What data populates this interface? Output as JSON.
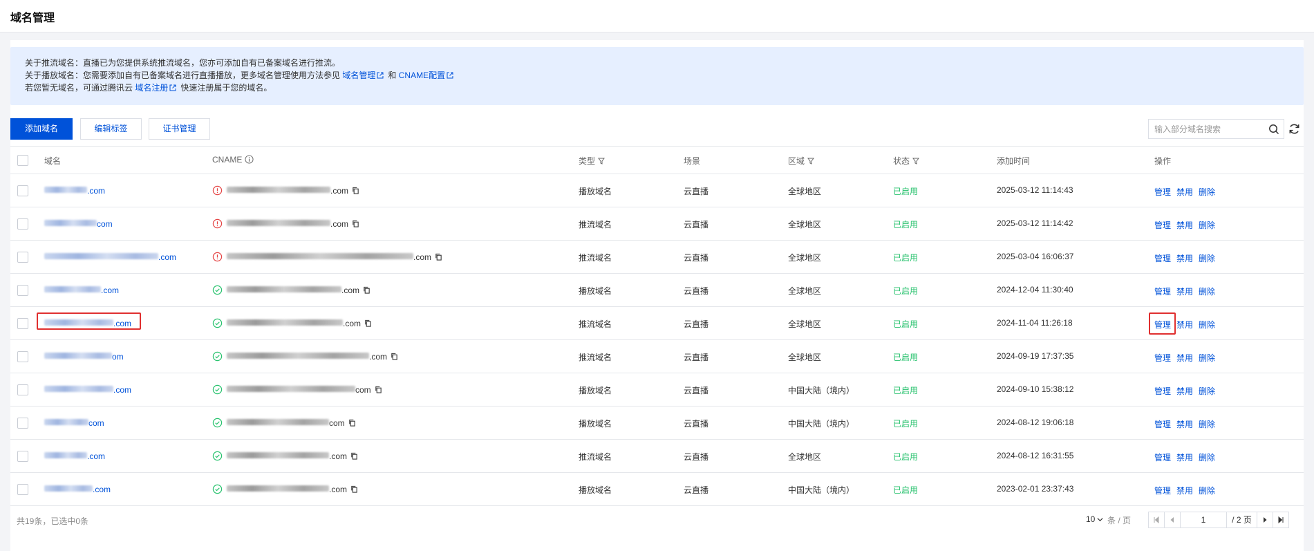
{
  "page": {
    "title": "域名管理"
  },
  "notice": {
    "line1": "关于推流域名：直播已为您提供系统推流域名，您亦可添加自有已备案域名进行推流。",
    "line2_prefix": "关于播放域名：您需要添加自有已备案域名进行直播播放，更多域名管理使用方法参见",
    "link_domain_mgmt": "域名管理",
    "line2_and": "和",
    "link_cname": "CNAME配置",
    "line3_prefix": "若您暂无域名，可通过腾讯云",
    "link_register": "域名注册",
    "line3_suffix": "快速注册属于您的域名。"
  },
  "toolbar": {
    "add_domain": "添加域名",
    "edit_tags": "编辑标签",
    "cert_mgmt": "证书管理",
    "search_placeholder": "输入部分域名搜索"
  },
  "table": {
    "headers": {
      "domain": "域名",
      "cname": "CNAME",
      "type": "类型",
      "scene": "场景",
      "region": "区域",
      "status": "状态",
      "added_time": "添加时间",
      "actions": "操作"
    },
    "rows": [
      {
        "domain_suffix": ".com",
        "cname_status": "error",
        "cname_suffix": ".com",
        "type": "播放域名",
        "scene": "云直播",
        "region": "全球地区",
        "status": "已启用",
        "time": "2025-03-12 11:14:43"
      },
      {
        "domain_suffix": "com",
        "cname_status": "error",
        "cname_suffix": ".com",
        "type": "推流域名",
        "scene": "云直播",
        "region": "全球地区",
        "status": "已启用",
        "time": "2025-03-12 11:14:42"
      },
      {
        "domain_suffix": ".com",
        "cname_status": "error",
        "cname_suffix": ".com",
        "type": "推流域名",
        "scene": "云直播",
        "region": "全球地区",
        "status": "已启用",
        "time": "2025-03-04 16:06:37"
      },
      {
        "domain_suffix": ".com",
        "cname_status": "ok",
        "cname_suffix": ".com",
        "type": "播放域名",
        "scene": "云直播",
        "region": "全球地区",
        "status": "已启用",
        "time": "2024-12-04 11:30:40"
      },
      {
        "domain_suffix": ".com",
        "cname_status": "ok",
        "cname_suffix": ".com",
        "type": "推流域名",
        "scene": "云直播",
        "region": "全球地区",
        "status": "已启用",
        "time": "2024-11-04 11:26:18"
      },
      {
        "domain_suffix": "om",
        "cname_status": "ok",
        "cname_suffix": ".com",
        "type": "推流域名",
        "scene": "云直播",
        "region": "全球地区",
        "status": "已启用",
        "time": "2024-09-19 17:37:35"
      },
      {
        "domain_suffix": ".com",
        "cname_status": "ok",
        "cname_suffix": "com",
        "type": "播放域名",
        "scene": "云直播",
        "region": "中国大陆（境内）",
        "status": "已启用",
        "time": "2024-09-10 15:38:12"
      },
      {
        "domain_suffix": "com",
        "cname_status": "ok",
        "cname_suffix": "com",
        "type": "播放域名",
        "scene": "云直播",
        "region": "中国大陆（境内）",
        "status": "已启用",
        "time": "2024-08-12 19:06:18"
      },
      {
        "domain_suffix": ".com",
        "cname_status": "ok",
        "cname_suffix": ".com",
        "type": "推流域名",
        "scene": "云直播",
        "region": "全球地区",
        "status": "已启用",
        "time": "2024-08-12 16:31:55"
      },
      {
        "domain_suffix": ".com",
        "cname_status": "ok",
        "cname_suffix": ".com",
        "type": "播放域名",
        "scene": "云直播",
        "region": "中国大陆（境内）",
        "status": "已启用",
        "time": "2023-02-01 23:37:43"
      }
    ],
    "actions": {
      "manage": "管理",
      "disable": "禁用",
      "delete": "删除"
    }
  },
  "footer": {
    "total": "共19条，已选中0条",
    "page_size": "10",
    "page_size_unit": "条 / 页",
    "current_page": "1",
    "total_pages": "/ 2 页"
  },
  "colors": {
    "accent": "#0052d9",
    "enabled": "#27c26d",
    "error": "#e54545",
    "highlight": "#e02f2f"
  }
}
